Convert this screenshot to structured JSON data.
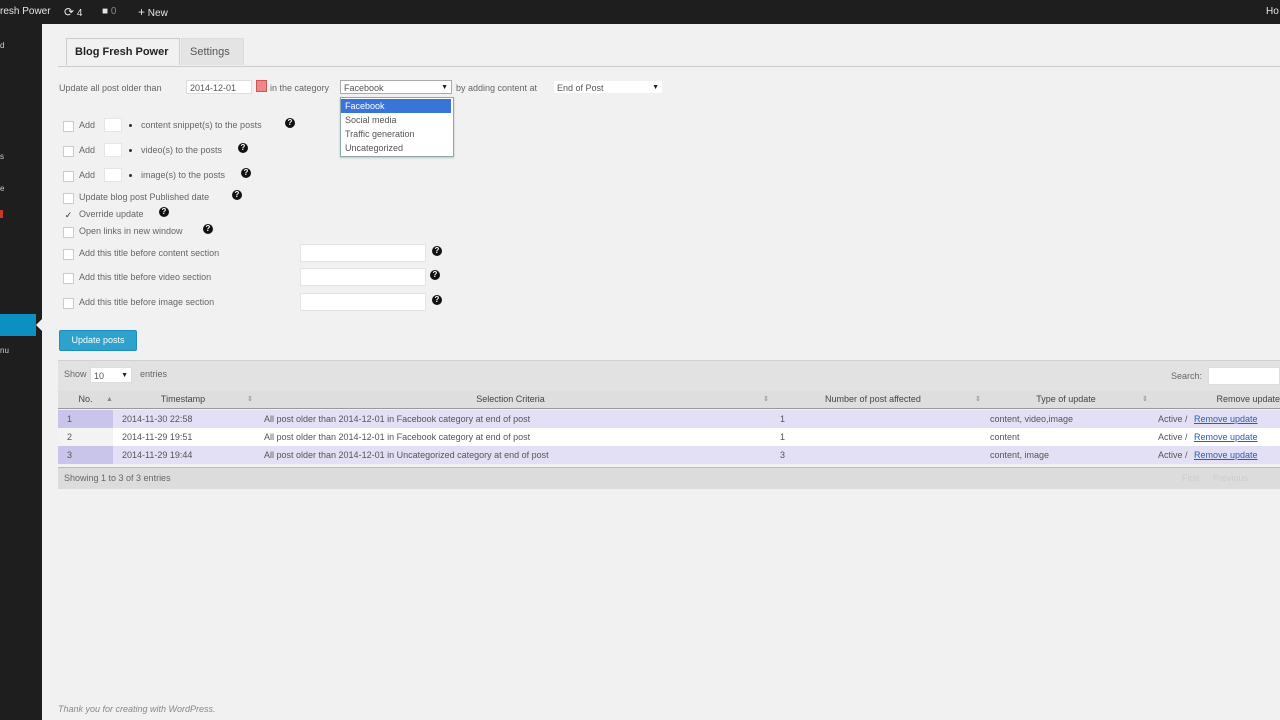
{
  "adminbar": {
    "site_name": "resh Power",
    "updates_count": "4",
    "comments_count": "0",
    "new_label": "New",
    "right_text": "Ho"
  },
  "sidebar": {
    "items": [
      "d",
      "s",
      "e",
      "nu"
    ]
  },
  "tabs": [
    {
      "label": "Blog Fresh Power",
      "active": true
    },
    {
      "label": "Settings",
      "active": false
    }
  ],
  "form": {
    "prefix_text": "Update all post older than",
    "date_value": "2014-12-01",
    "in_category_text": "in the category",
    "category_value": "Facebook",
    "category_options": [
      "Facebook",
      "Social media",
      "Traffic generation",
      "Uncategorized"
    ],
    "adding_text": "by adding content at",
    "position_value": "End of Post",
    "add_label": "Add",
    "snippets_text": "content snippet(s) to the posts",
    "videos_text": "video(s) to the posts",
    "images_text": "image(s) to the posts",
    "published_date_text": "Update blog post Published date",
    "override_text": "Override update",
    "open_links_text": "Open links in new window",
    "title_content_text": "Add this title before content section",
    "title_video_text": "Add this title before video section",
    "title_image_text": "Add this title before image section",
    "submit_label": "Update posts",
    "override_checked": true
  },
  "table": {
    "show_label": "Show",
    "page_size": "10",
    "entries_label": "entries",
    "search_label": "Search:",
    "columns": [
      "No.",
      "Timestamp",
      "Selection Criteria",
      "Number of post affected",
      "Type of update",
      "Remove update"
    ],
    "rows": [
      {
        "no": "1",
        "timestamp": "2014-11-30 22:58",
        "criteria": "All post older than 2014-12-01 in Facebook category at end of post",
        "count": "1",
        "type": "content, video,image",
        "status": "Active /",
        "action": "Remove update"
      },
      {
        "no": "2",
        "timestamp": "2014-11-29 19:51",
        "criteria": "All post older than 2014-12-01 in Facebook category at end of post",
        "count": "1",
        "type": "content",
        "status": "Active /",
        "action": "Remove update"
      },
      {
        "no": "3",
        "timestamp": "2014-11-29 19:44",
        "criteria": "All post older than 2014-12-01 in Uncategorized category at end of post",
        "count": "3",
        "type": "content, image",
        "status": "Active /",
        "action": "Remove update"
      }
    ],
    "info_text": "Showing 1 to 3 of 3 entries",
    "prev_label": "First",
    "next_label": "Previous"
  },
  "footer_text": "Thank you for creating with WordPress."
}
